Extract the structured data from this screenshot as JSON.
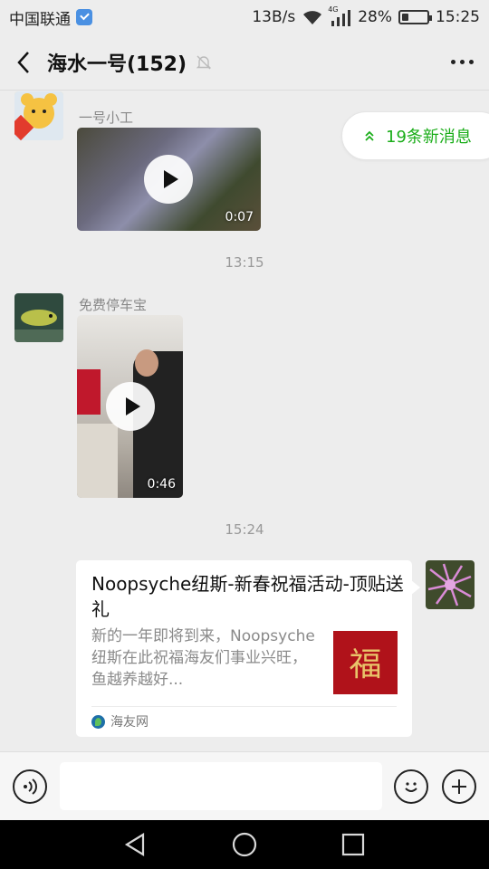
{
  "status_bar": {
    "carrier": "中国联通",
    "net_speed": "13B/s",
    "network_type": "4G",
    "battery_percent": "28%",
    "battery_level": 0.28,
    "time": "15:25"
  },
  "header": {
    "title": "海水一号(152)",
    "back_icon": "chevron-left-icon",
    "mute_icon": "bell-off-icon",
    "more_icon": "more-dots-icon"
  },
  "new_messages": {
    "label": "19条新消息",
    "color": "#1aad19"
  },
  "messages": [
    {
      "type": "video",
      "sender": "一号小工",
      "duration": "0:07"
    },
    {
      "type": "time",
      "label": "13:15"
    },
    {
      "type": "video",
      "sender": "免费停车宝",
      "duration": "0:46"
    },
    {
      "type": "time",
      "label": "15:24"
    },
    {
      "type": "link",
      "title": "Noopsyche纽斯-新春祝福活动-顶贴送礼",
      "description": "新的一年即将到来，Noopsyche纽斯在此祝福海友们事业兴旺，鱼越养越好...",
      "thumb_text": "福",
      "source": "海友网"
    }
  ],
  "input_bar": {
    "voice_icon": "voice-icon",
    "emoji_icon": "emoji-icon",
    "plus_icon": "plus-icon",
    "placeholder": ""
  },
  "nav_bar": {
    "back_icon": "triangle-back-icon",
    "home_icon": "circle-home-icon",
    "recent_icon": "square-recent-icon"
  }
}
